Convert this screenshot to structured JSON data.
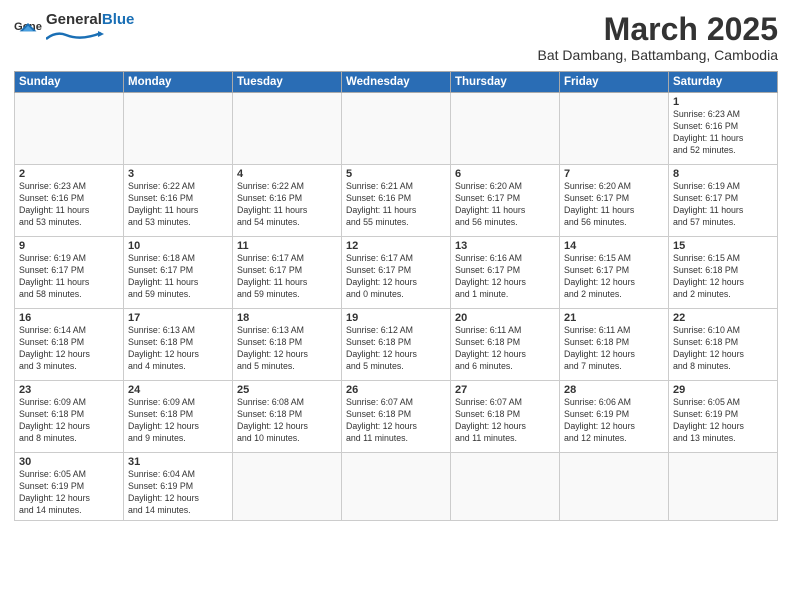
{
  "logo": {
    "text_general": "General",
    "text_blue": "Blue"
  },
  "title": "March 2025",
  "subtitle": "Bat Dambang, Battambang, Cambodia",
  "weekdays": [
    "Sunday",
    "Monday",
    "Tuesday",
    "Wednesday",
    "Thursday",
    "Friday",
    "Saturday"
  ],
  "weeks": [
    [
      {
        "day": "",
        "info": ""
      },
      {
        "day": "",
        "info": ""
      },
      {
        "day": "",
        "info": ""
      },
      {
        "day": "",
        "info": ""
      },
      {
        "day": "",
        "info": ""
      },
      {
        "day": "",
        "info": ""
      },
      {
        "day": "1",
        "info": "Sunrise: 6:23 AM\nSunset: 6:16 PM\nDaylight: 11 hours\nand 52 minutes."
      }
    ],
    [
      {
        "day": "2",
        "info": "Sunrise: 6:23 AM\nSunset: 6:16 PM\nDaylight: 11 hours\nand 53 minutes."
      },
      {
        "day": "3",
        "info": "Sunrise: 6:22 AM\nSunset: 6:16 PM\nDaylight: 11 hours\nand 53 minutes."
      },
      {
        "day": "4",
        "info": "Sunrise: 6:22 AM\nSunset: 6:16 PM\nDaylight: 11 hours\nand 54 minutes."
      },
      {
        "day": "5",
        "info": "Sunrise: 6:21 AM\nSunset: 6:16 PM\nDaylight: 11 hours\nand 55 minutes."
      },
      {
        "day": "6",
        "info": "Sunrise: 6:20 AM\nSunset: 6:17 PM\nDaylight: 11 hours\nand 56 minutes."
      },
      {
        "day": "7",
        "info": "Sunrise: 6:20 AM\nSunset: 6:17 PM\nDaylight: 11 hours\nand 56 minutes."
      },
      {
        "day": "8",
        "info": "Sunrise: 6:19 AM\nSunset: 6:17 PM\nDaylight: 11 hours\nand 57 minutes."
      }
    ],
    [
      {
        "day": "9",
        "info": "Sunrise: 6:19 AM\nSunset: 6:17 PM\nDaylight: 11 hours\nand 58 minutes."
      },
      {
        "day": "10",
        "info": "Sunrise: 6:18 AM\nSunset: 6:17 PM\nDaylight: 11 hours\nand 59 minutes."
      },
      {
        "day": "11",
        "info": "Sunrise: 6:17 AM\nSunset: 6:17 PM\nDaylight: 11 hours\nand 59 minutes."
      },
      {
        "day": "12",
        "info": "Sunrise: 6:17 AM\nSunset: 6:17 PM\nDaylight: 12 hours\nand 0 minutes."
      },
      {
        "day": "13",
        "info": "Sunrise: 6:16 AM\nSunset: 6:17 PM\nDaylight: 12 hours\nand 1 minute."
      },
      {
        "day": "14",
        "info": "Sunrise: 6:15 AM\nSunset: 6:17 PM\nDaylight: 12 hours\nand 2 minutes."
      },
      {
        "day": "15",
        "info": "Sunrise: 6:15 AM\nSunset: 6:18 PM\nDaylight: 12 hours\nand 2 minutes."
      }
    ],
    [
      {
        "day": "16",
        "info": "Sunrise: 6:14 AM\nSunset: 6:18 PM\nDaylight: 12 hours\nand 3 minutes."
      },
      {
        "day": "17",
        "info": "Sunrise: 6:13 AM\nSunset: 6:18 PM\nDaylight: 12 hours\nand 4 minutes."
      },
      {
        "day": "18",
        "info": "Sunrise: 6:13 AM\nSunset: 6:18 PM\nDaylight: 12 hours\nand 5 minutes."
      },
      {
        "day": "19",
        "info": "Sunrise: 6:12 AM\nSunset: 6:18 PM\nDaylight: 12 hours\nand 5 minutes."
      },
      {
        "day": "20",
        "info": "Sunrise: 6:11 AM\nSunset: 6:18 PM\nDaylight: 12 hours\nand 6 minutes."
      },
      {
        "day": "21",
        "info": "Sunrise: 6:11 AM\nSunset: 6:18 PM\nDaylight: 12 hours\nand 7 minutes."
      },
      {
        "day": "22",
        "info": "Sunrise: 6:10 AM\nSunset: 6:18 PM\nDaylight: 12 hours\nand 8 minutes."
      }
    ],
    [
      {
        "day": "23",
        "info": "Sunrise: 6:09 AM\nSunset: 6:18 PM\nDaylight: 12 hours\nand 8 minutes."
      },
      {
        "day": "24",
        "info": "Sunrise: 6:09 AM\nSunset: 6:18 PM\nDaylight: 12 hours\nand 9 minutes."
      },
      {
        "day": "25",
        "info": "Sunrise: 6:08 AM\nSunset: 6:18 PM\nDaylight: 12 hours\nand 10 minutes."
      },
      {
        "day": "26",
        "info": "Sunrise: 6:07 AM\nSunset: 6:18 PM\nDaylight: 12 hours\nand 11 minutes."
      },
      {
        "day": "27",
        "info": "Sunrise: 6:07 AM\nSunset: 6:18 PM\nDaylight: 12 hours\nand 11 minutes."
      },
      {
        "day": "28",
        "info": "Sunrise: 6:06 AM\nSunset: 6:19 PM\nDaylight: 12 hours\nand 12 minutes."
      },
      {
        "day": "29",
        "info": "Sunrise: 6:05 AM\nSunset: 6:19 PM\nDaylight: 12 hours\nand 13 minutes."
      }
    ],
    [
      {
        "day": "30",
        "info": "Sunrise: 6:05 AM\nSunset: 6:19 PM\nDaylight: 12 hours\nand 14 minutes."
      },
      {
        "day": "31",
        "info": "Sunrise: 6:04 AM\nSunset: 6:19 PM\nDaylight: 12 hours\nand 14 minutes."
      },
      {
        "day": "",
        "info": ""
      },
      {
        "day": "",
        "info": ""
      },
      {
        "day": "",
        "info": ""
      },
      {
        "day": "",
        "info": ""
      },
      {
        "day": "",
        "info": ""
      }
    ]
  ]
}
